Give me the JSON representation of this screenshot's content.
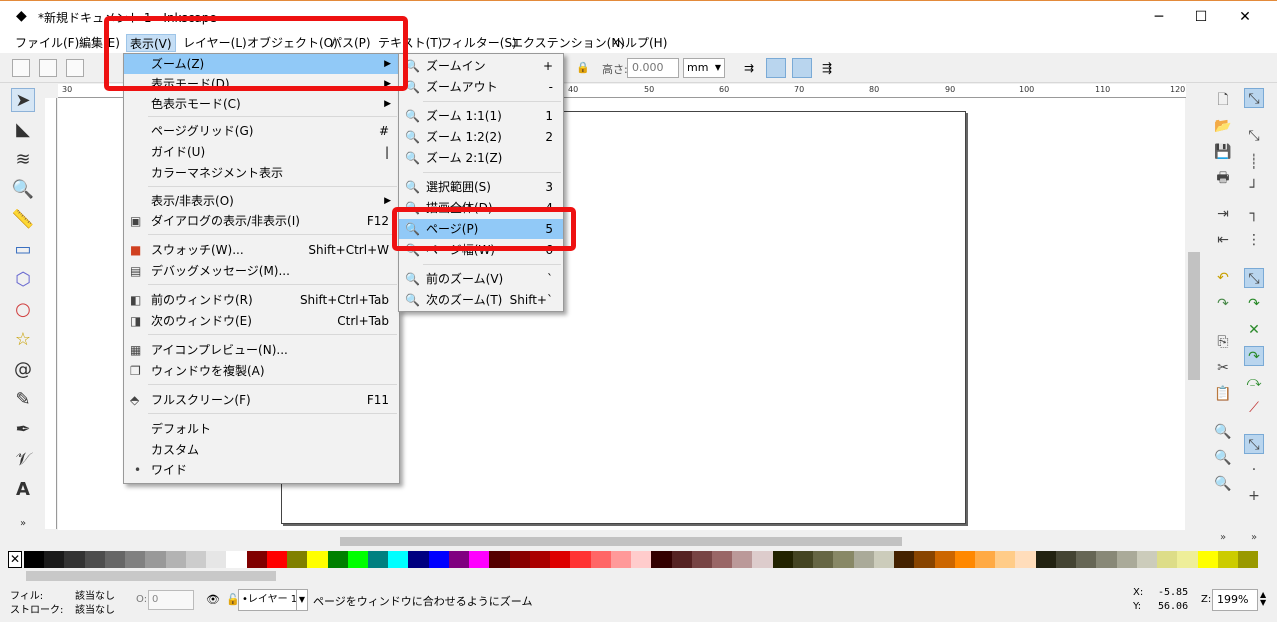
{
  "window": {
    "title": "*新規ドキュメント 1 - Inkscape",
    "minimize": "─",
    "maximize": "☐",
    "close": "✕"
  },
  "menubar": [
    "ファイル(F)",
    "編集(E)",
    "表示(V)",
    "レイヤー(L)",
    "オブジェクト(O)",
    "パス(P)",
    "テキスト(T)",
    "フィルター(S)",
    "エクステンション(N)",
    "ヘルプ(H)"
  ],
  "toolbar": {
    "height_label": "高さ:",
    "height_value": "0.000",
    "unit": "mm"
  },
  "view_menu": [
    {
      "label": "ズーム(Z)",
      "arrow": "▶"
    },
    {
      "label": "表示モード(D)",
      "arrow": "▶"
    },
    {
      "label": "色表示モード(C)",
      "arrow": "▶"
    },
    {
      "label": "ページグリッド(G)",
      "shortcut": "#"
    },
    {
      "label": "ガイド(U)",
      "shortcut": "|"
    },
    {
      "label": "カラーマネジメント表示"
    },
    {
      "label": "表示/非表示(O)",
      "arrow": "▶"
    },
    {
      "label": "ダイアログの表示/非表示(I)",
      "shortcut": "F12"
    },
    {
      "label": "スウォッチ(W)...",
      "shortcut": "Shift+Ctrl+W"
    },
    {
      "label": "デバッグメッセージ(M)..."
    },
    {
      "label": "前のウィンドウ(R)",
      "shortcut": "Shift+Ctrl+Tab"
    },
    {
      "label": "次のウィンドウ(E)",
      "shortcut": "Ctrl+Tab"
    },
    {
      "label": "アイコンプレビュー(N)..."
    },
    {
      "label": "ウィンドウを複製(A)"
    },
    {
      "label": "フルスクリーン(F)",
      "shortcut": "F11"
    },
    {
      "label": "デフォルト"
    },
    {
      "label": "カスタム"
    },
    {
      "label": "ワイド",
      "bullet": "•"
    }
  ],
  "zoom_menu": [
    {
      "label": "ズームイン",
      "shortcut": "+"
    },
    {
      "label": "ズームアウト",
      "shortcut": "-"
    },
    {
      "label": "ズーム 1:1(1)",
      "shortcut": "1"
    },
    {
      "label": "ズーム 1:2(2)",
      "shortcut": "2"
    },
    {
      "label": "ズーム 2:1(Z)",
      "shortcut": ""
    },
    {
      "label": "選択範囲(S)",
      "shortcut": "3"
    },
    {
      "label": "描画全体(D)",
      "shortcut": "4"
    },
    {
      "label": "ページ(P)",
      "shortcut": "5"
    },
    {
      "label": "ページ幅(W)",
      "shortcut": "6"
    },
    {
      "label": "前のズーム(V)",
      "shortcut": "`"
    },
    {
      "label": "次のズーム(T)",
      "shortcut": "Shift+`"
    }
  ],
  "ruler_top": [
    "30",
    "40",
    "50",
    "60",
    "70",
    "80",
    "90",
    "100",
    "110",
    "120"
  ],
  "status": {
    "fill_label": "フィル:",
    "fill_value": "該当なし",
    "stroke_label": "ストローク:",
    "stroke_value": "該当なし",
    "opacity_label": "O:",
    "opacity_value": "0",
    "layer": "•レイヤー 1",
    "message": "ページをウィンドウに合わせるようにズーム",
    "x_label": "X:",
    "x_value": "-5.85",
    "y_label": "Y:",
    "y_value": "56.06",
    "zoom_label": "Z:",
    "zoom_value": "199%"
  },
  "colors": {
    "highlight": "#91c9f7",
    "annotation": "#ee1111"
  }
}
